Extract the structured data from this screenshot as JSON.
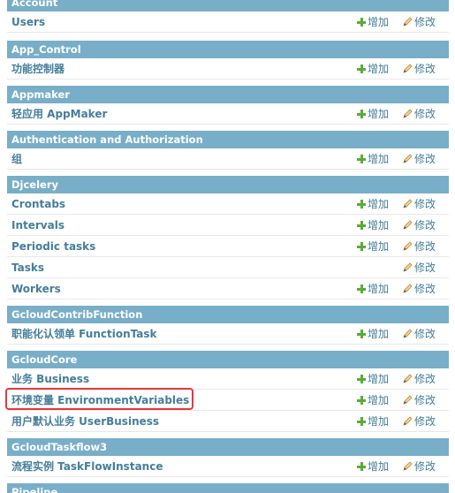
{
  "actions": {
    "add_label": "增加",
    "change_label": "修改"
  },
  "modules": [
    {
      "caption": "Account",
      "rows": [
        {
          "name": "Users",
          "add": true
        }
      ]
    },
    {
      "caption": "App_Control",
      "rows": [
        {
          "name": "功能控制器",
          "add": true
        }
      ]
    },
    {
      "caption": "Appmaker",
      "rows": [
        {
          "name": "轻应用 AppMaker",
          "add": true
        }
      ]
    },
    {
      "caption": "Authentication and Authorization",
      "rows": [
        {
          "name": "组",
          "add": true
        }
      ]
    },
    {
      "caption": "Djcelery",
      "rows": [
        {
          "name": "Crontabs",
          "add": true
        },
        {
          "name": "Intervals",
          "add": true
        },
        {
          "name": "Periodic tasks",
          "add": true
        },
        {
          "name": "Tasks",
          "add": false
        },
        {
          "name": "Workers",
          "add": true
        }
      ]
    },
    {
      "caption": "GcloudContribFunction",
      "rows": [
        {
          "name": "职能化认领单 FunctionTask",
          "add": true
        }
      ]
    },
    {
      "caption": "GcloudCore",
      "rows": [
        {
          "name": "业务 Business",
          "add": true
        },
        {
          "name": "环境变量 EnvironmentVariables",
          "add": true,
          "highlighted": true
        },
        {
          "name": "用户默认业务 UserBusiness",
          "add": true
        }
      ]
    },
    {
      "caption": "GcloudTaskflow3",
      "rows": [
        {
          "name": "流程实例 TaskFlowInstance",
          "add": true
        }
      ]
    },
    {
      "caption": "Pipeline",
      "rows": []
    }
  ],
  "colors": {
    "caption_bg": "#79aec8",
    "link": "#447e9b",
    "add_icon": "#5bab38",
    "highlight": "#e5383b"
  }
}
